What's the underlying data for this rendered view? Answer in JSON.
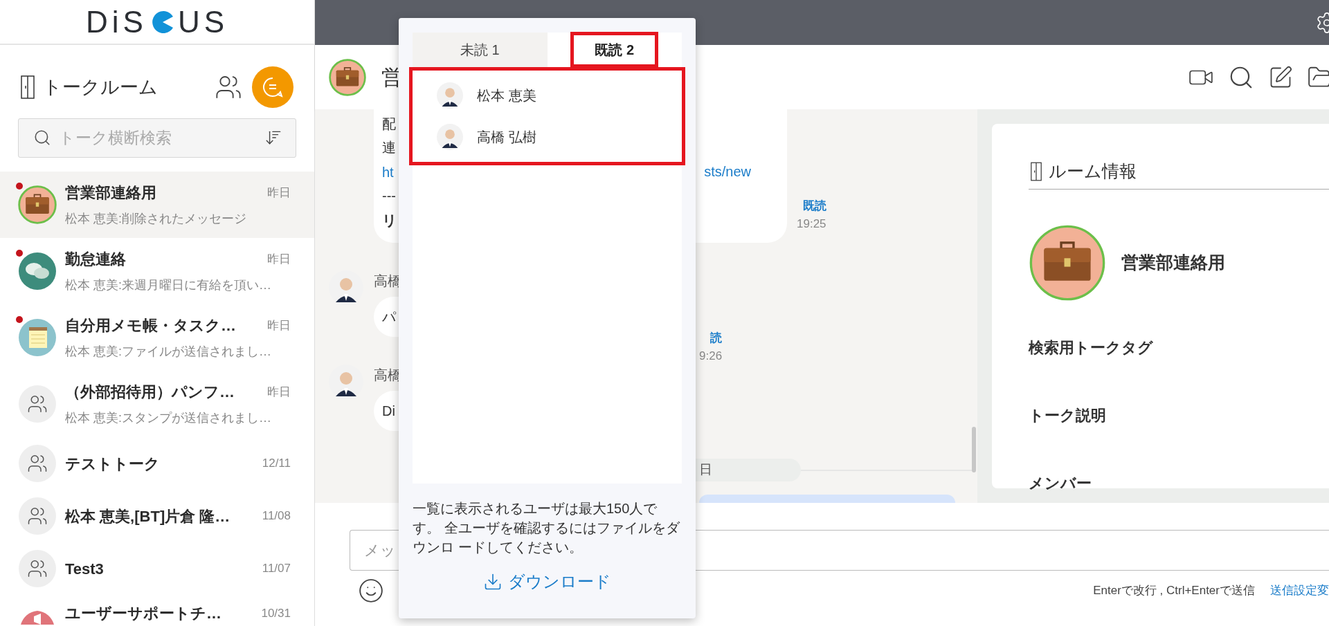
{
  "sidebar": {
    "logo": {
      "left": "DiS",
      "right": "US"
    },
    "title": "トークルーム",
    "search": {
      "placeholder": "トーク横断検索"
    },
    "rooms": [
      {
        "name": "営業部連絡用",
        "date": "昨日",
        "preview": "松本 恵美:削除されたメッセージ",
        "kind": "briefcase",
        "pinned": true,
        "selected": true
      },
      {
        "name": "勤怠連絡",
        "date": "昨日",
        "preview": "松本 恵美:来週月曜日に有給を頂い…",
        "kind": "chat",
        "pinned": true,
        "selected": false
      },
      {
        "name": "自分用メモ帳・タスク…",
        "date": "昨日",
        "preview": "松本 恵美:ファイルが送信されまし…",
        "kind": "notepad",
        "pinned": true,
        "selected": false
      },
      {
        "name": "（外部招待用）パンフ…",
        "date": "昨日",
        "preview": "松本 恵美:スタンプが送信されまし…",
        "kind": "group",
        "pinned": false,
        "selected": false
      },
      {
        "name": "テストトーク",
        "date": "12/11",
        "kind": "group",
        "pinned": false,
        "selected": false
      },
      {
        "name": "松本 恵美,[BT]片倉 隆…",
        "date": "11/08",
        "kind": "group",
        "pinned": false,
        "selected": false
      },
      {
        "name": "Test3",
        "date": "11/07",
        "kind": "group",
        "pinned": false,
        "selected": false
      },
      {
        "name": "ユーザーサポートチ…",
        "date": "10/31",
        "kind": "announce",
        "pinned": false,
        "selected": false
      }
    ]
  },
  "chat": {
    "title": "営",
    "bubble_lines": [
      {
        "text": "配",
        "kind": "plain"
      },
      {
        "text": "連",
        "kind": "plain"
      },
      {
        "text": "ht",
        "kind": "link"
      },
      {
        "text": "---",
        "kind": "plain"
      },
      {
        "text": "リ",
        "kind": "bold"
      }
    ],
    "link_tail": "sts/new",
    "first_status": "既読",
    "first_time": "19:25",
    "messages": [
      {
        "sender": "高橋",
        "text": "パ",
        "status": "読",
        "time": "9:26"
      },
      {
        "sender": "高橋",
        "text": "Di"
      }
    ],
    "date_divider": "日",
    "input": {
      "placeholder": "メッ"
    },
    "hint": "Enterで改行 , Ctrl+Enterで送信",
    "settings_link": "送信設定変"
  },
  "room_info": {
    "title": "ルーム情報",
    "name": "営業部連絡用",
    "sections": [
      "検索用トークタグ",
      "トーク説明",
      "メンバー"
    ]
  },
  "read_popover": {
    "tabs": [
      {
        "label": "未読 1",
        "selected": false
      },
      {
        "label": "既読 2",
        "selected": true
      }
    ],
    "users": [
      "松本 恵美",
      "高橋 弘樹"
    ],
    "note": "一覧に表示されるユーザは最大150人です。 全ユーザを確認するにはファイルをダウンロ ードしてください。",
    "download": "ダウンロード"
  }
}
